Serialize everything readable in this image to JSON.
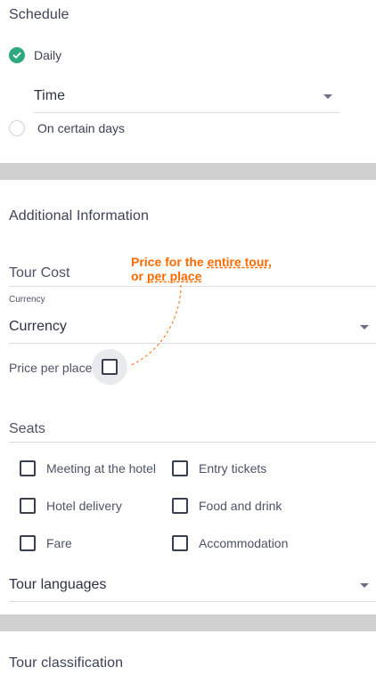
{
  "schedule": {
    "title": "Schedule",
    "daily_label": "Daily",
    "time_select_value": "Time",
    "certain_days_label": "On certain days"
  },
  "additional": {
    "title": "Additional Information",
    "tour_cost_placeholder": "Tour Cost",
    "currency_small_label": "Currency",
    "currency_select_value": "Currency",
    "price_per_place_label": "Price per place",
    "tooltip_line1_prefix": "Price for the ",
    "tooltip_line1_link": "entire tour,",
    "tooltip_line2_prefix": "or ",
    "tooltip_line2_link": "per place",
    "seats_placeholder": "Seats",
    "options_left": [
      "Meeting at the hotel",
      "Hotel delivery",
      "Fare"
    ],
    "options_right": [
      "Entry tickets",
      "Food and drink",
      "Accommodation"
    ],
    "tour_languages_value": "Tour languages"
  },
  "classification": {
    "title": "Tour classification"
  },
  "colors": {
    "accent_green": "#2ea87e",
    "tooltip_orange": "#ff6a00",
    "divider_gray": "#d0d0d0"
  }
}
